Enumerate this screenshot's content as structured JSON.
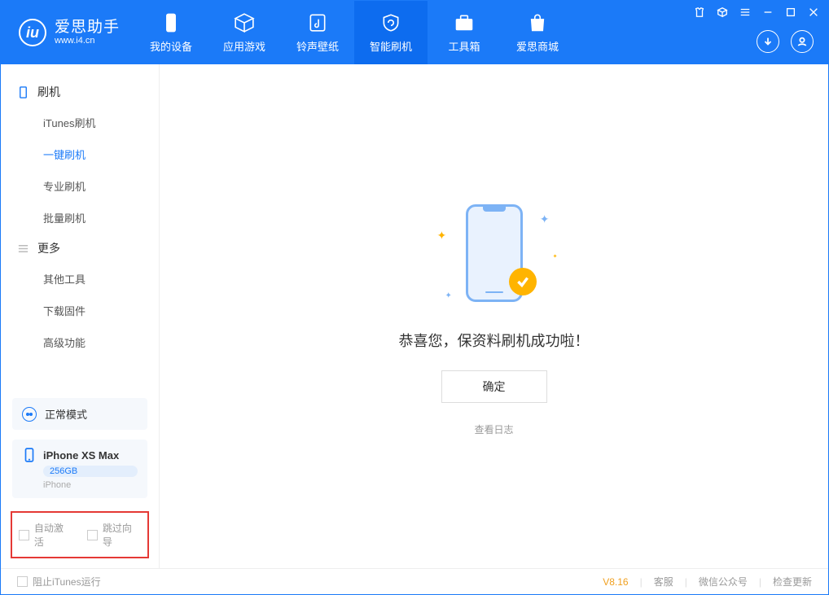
{
  "app": {
    "title": "爱思助手",
    "subtitle": "www.i4.cn"
  },
  "tabs": [
    {
      "label": "我的设备"
    },
    {
      "label": "应用游戏"
    },
    {
      "label": "铃声壁纸"
    },
    {
      "label": "智能刷机"
    },
    {
      "label": "工具箱"
    },
    {
      "label": "爱思商城"
    }
  ],
  "sidebar": {
    "group1": {
      "title": "刷机",
      "items": [
        "iTunes刷机",
        "一键刷机",
        "专业刷机",
        "批量刷机"
      ]
    },
    "group2": {
      "title": "更多",
      "items": [
        "其他工具",
        "下载固件",
        "高级功能"
      ]
    }
  },
  "mode": {
    "label": "正常模式"
  },
  "device": {
    "name": "iPhone XS Max",
    "storage": "256GB",
    "type": "iPhone"
  },
  "options": {
    "auto_activate": "自动激活",
    "skip_guide": "跳过向导"
  },
  "main": {
    "success_message": "恭喜您，保资料刷机成功啦！",
    "confirm": "确定",
    "view_log": "查看日志"
  },
  "footer": {
    "block_itunes": "阻止iTunes运行",
    "version": "V8.16",
    "links": [
      "客服",
      "微信公众号",
      "检查更新"
    ]
  }
}
